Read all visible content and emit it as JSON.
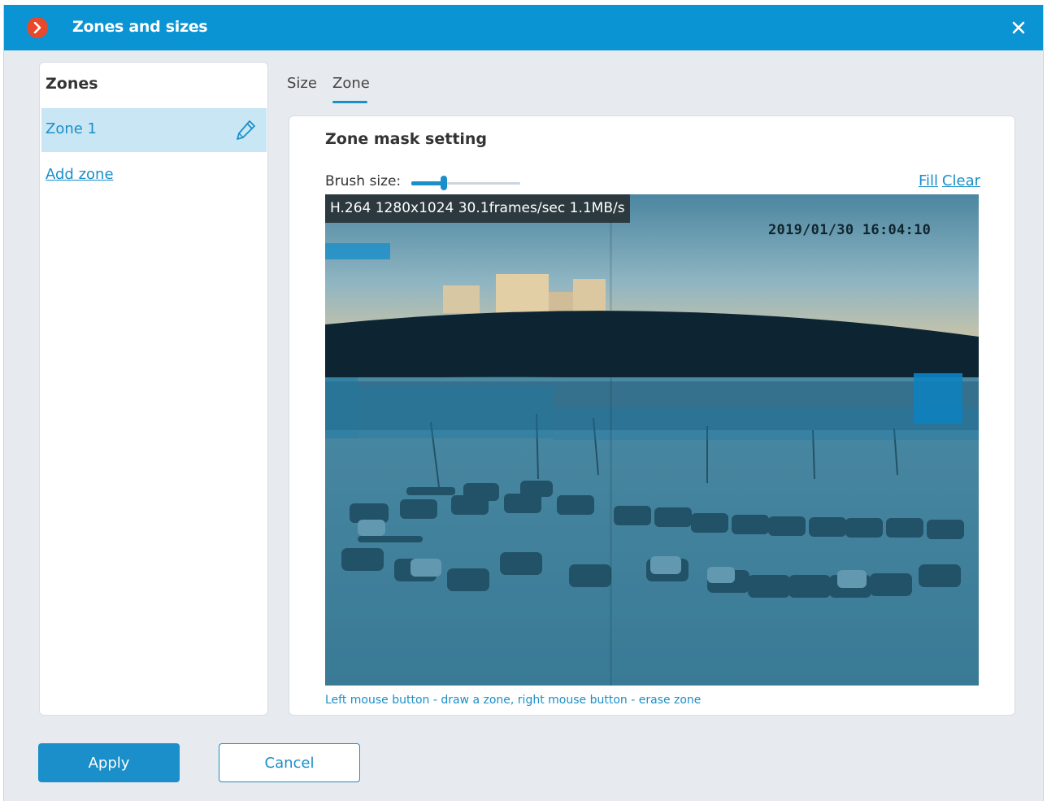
{
  "window": {
    "title": "Zones and sizes",
    "app_icon": "chevron-right-circle-icon",
    "close_icon": "close-icon",
    "accent_color": "#0a94d4",
    "brand_color": "#e8482b"
  },
  "zones_panel": {
    "header": "Zones",
    "items": [
      {
        "label": "Zone 1",
        "selected": true,
        "edit_icon": "pencil-icon"
      }
    ],
    "add_zone_label": "Add zone"
  },
  "tabs": [
    {
      "label": "Size",
      "active": false
    },
    {
      "label": "Zone",
      "active": true
    }
  ],
  "zone_mask": {
    "title": "Zone mask setting",
    "brush_size_label": "Brush size:",
    "brush_size_level": 0.3,
    "fill_label": "Fill",
    "clear_label": "Clear",
    "video_info": "H.264 1280x1024 30.1frames/sec 1.1MB/s",
    "timestamp": "2019/01/30 16:04:10",
    "hint": "Left mouse button - draw a zone, right mouse button - erase zone"
  },
  "footer": {
    "apply_label": "Apply",
    "cancel_label": "Cancel"
  }
}
